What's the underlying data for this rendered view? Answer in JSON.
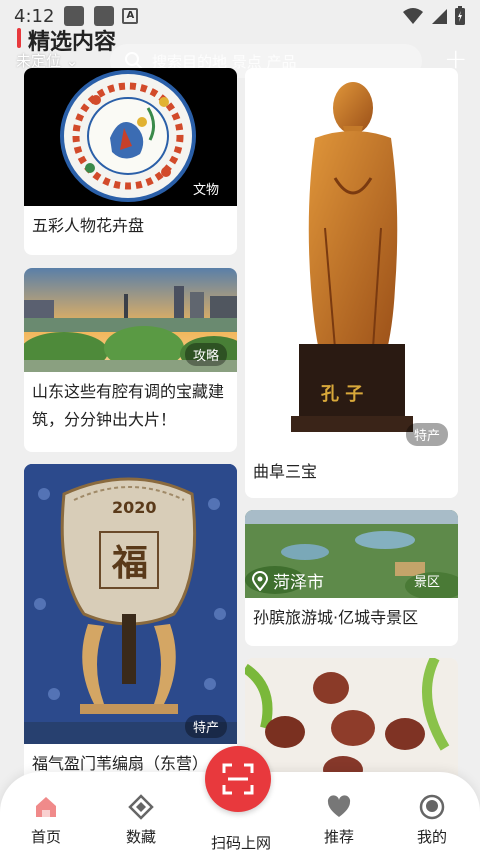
{
  "status": {
    "time": "4:12",
    "a_badge": "A"
  },
  "header": {
    "title": "精选内容",
    "location": "未定位",
    "search_placeholder": "搜索目的地 景点 产品",
    "plus": "+"
  },
  "cards": [
    {
      "tag": "文物",
      "caption": "五彩人物花卉盘"
    },
    {
      "tag": "攻略",
      "caption": "山东这些有腔有调的宝藏建筑，分分钟出大片！"
    },
    {
      "tag": "特产",
      "caption": "福气盈门苇编扇（东营）"
    },
    {
      "tag": "特产",
      "caption": "曲阜三宝",
      "plaque": "孔 子"
    },
    {
      "tag": "景区",
      "caption": "孙膑旅游城·亿城寺景区",
      "city": "菏泽市"
    },
    {
      "tag": "",
      "caption": ""
    }
  ],
  "fan_text": {
    "year": "2020",
    "char": "福"
  },
  "nav": {
    "home": "首页",
    "collection": "数藏",
    "scan": "扫码上网",
    "recommend": "推荐",
    "mine": "我的"
  },
  "colors": {
    "accent": "#e8393d"
  }
}
